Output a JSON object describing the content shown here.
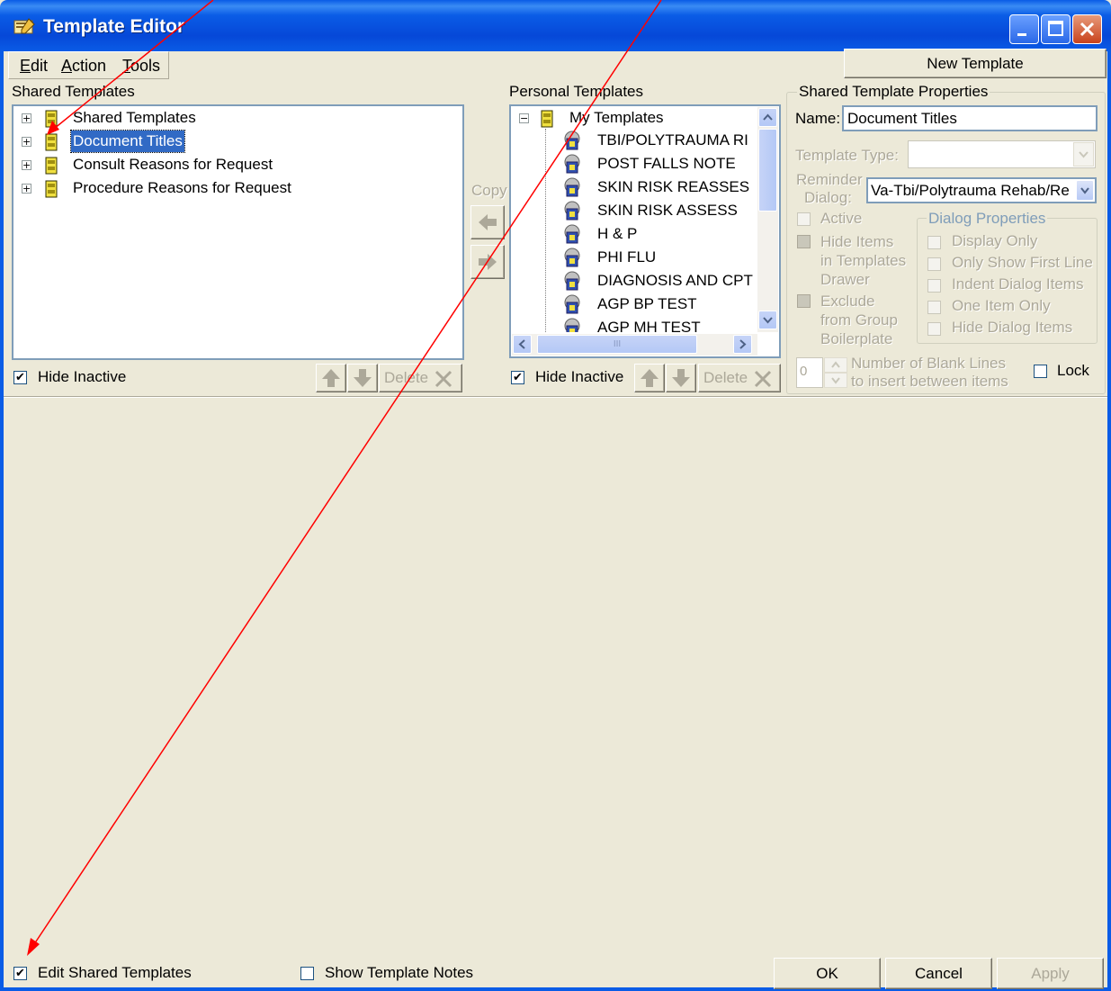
{
  "window": {
    "title": "Template Editor",
    "accent": "#0a5ce6",
    "annotation_color": "#ff0000"
  },
  "menu": [
    "Edit",
    "Action",
    "Tools"
  ],
  "new_template_label": "New Template",
  "shared": {
    "header": "Shared Templates",
    "items": [
      "Shared Templates",
      "Document Titles",
      "Consult Reasons for Request",
      "Procedure Reasons for Request"
    ],
    "selected_index": 1,
    "hide_inactive_label": "Hide Inactive",
    "hide_inactive_checked": true,
    "delete_label": "Delete"
  },
  "copy_label": "Copy",
  "personal": {
    "header": "Personal Templates",
    "root": "My Templates",
    "items": [
      "TBI/POLYTRAUMA RI",
      "POST FALLS NOTE",
      "SKIN RISK REASSES",
      "SKIN RISK ASSESS",
      "H & P",
      "PHI FLU",
      "DIAGNOSIS AND CPT",
      "AGP BP TEST",
      "AGP MH TEST"
    ],
    "hide_inactive_label": "Hide Inactive",
    "hide_inactive_checked": true,
    "delete_label": "Delete",
    "hscroll_grip": "III"
  },
  "properties": {
    "header": "Shared Template Properties",
    "name_label": "Name:",
    "name_value": "Document Titles",
    "template_type_label": "Template Type:",
    "template_type_value": "",
    "reminder_label_1": "Reminder",
    "reminder_label_2": "Dialog:",
    "reminder_value": "Va-Tbi/Polytrauma Rehab/Re",
    "active_label": "Active",
    "hide_items_1": "Hide Items",
    "hide_items_2": "in Templates",
    "hide_items_3": "Drawer",
    "exclude_1": "Exclude",
    "exclude_2": "from Group",
    "exclude_3": "Boilerplate",
    "dialog_properties_label": "Dialog Properties",
    "dialog_options": [
      "Display Only",
      "Only Show First Line",
      "Indent Dialog Items",
      "One Item Only",
      "Hide Dialog Items"
    ],
    "blank_lines_value": "0",
    "blank_lines_label_1": "Number of Blank Lines",
    "blank_lines_label_2": "to insert between items",
    "lock_label": "Lock"
  },
  "footer": {
    "edit_shared_label": "Edit Shared Templates",
    "edit_shared_checked": true,
    "show_notes_label": "Show Template Notes",
    "show_notes_checked": false,
    "ok_label": "OK",
    "cancel_label": "Cancel",
    "apply_label": "Apply"
  },
  "check_glyph": "✔",
  "plus_glyph": "+",
  "minus_glyph": "−"
}
